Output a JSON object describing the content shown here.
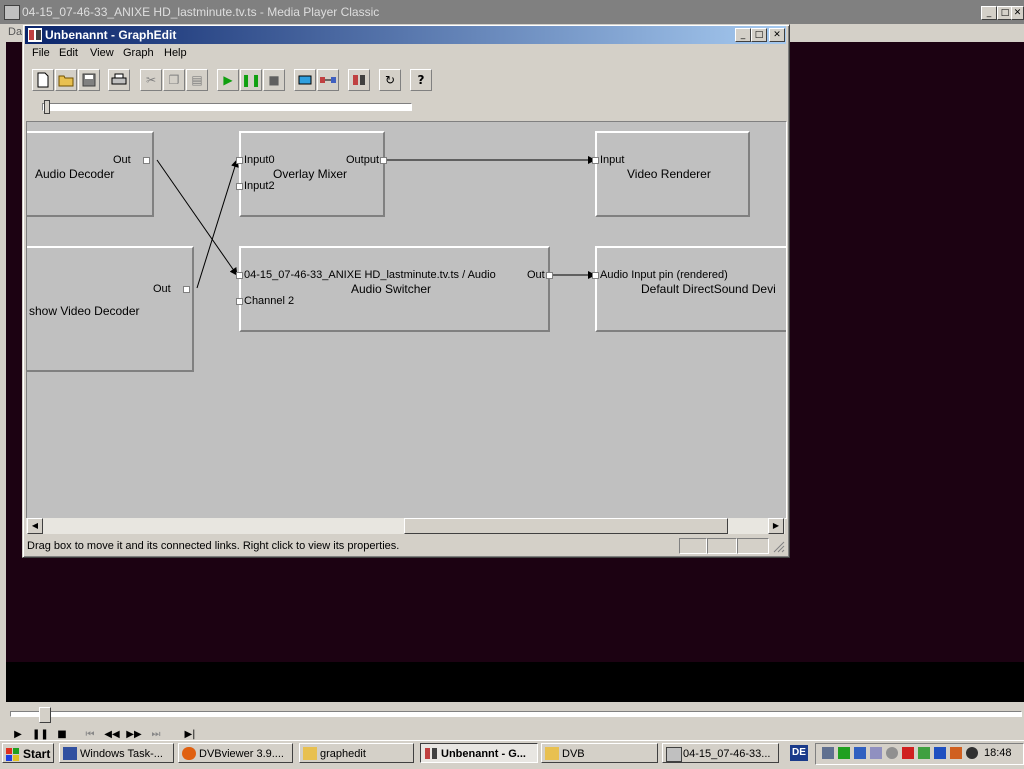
{
  "mpc": {
    "title": "04-15_07-46-33_ANIXE HD_lastminute.tv.ts - Media Player Classic",
    "menu_partial": "Da",
    "playback_buttons": [
      "play-icon",
      "pause-icon",
      "stop-icon",
      "skip-back-icon",
      "frame-back-icon",
      "frame-forward-icon",
      "skip-forward-icon",
      "frame-step-icon"
    ]
  },
  "graphedit": {
    "title": "Unbenannt - GraphEdit",
    "menu": [
      "File",
      "Edit",
      "View",
      "Graph",
      "Help"
    ],
    "toolbar_icons": [
      "new-icon",
      "open-icon",
      "save-icon",
      "print-icon",
      "cut-icon",
      "copy-icon",
      "paste-icon",
      "play-icon",
      "pause-icon",
      "stop-icon",
      "seek-icon",
      "connect-icon",
      "filter-icon",
      "refresh-icon",
      "help-icon"
    ],
    "filters": {
      "audio_decoder": {
        "name": "Audio Decoder",
        "pins": {
          "out": "Out"
        }
      },
      "overlay_mixer": {
        "name": "Overlay Mixer",
        "pins": {
          "input0": "Input0",
          "input2": "Input2",
          "output": "Output"
        }
      },
      "video_renderer": {
        "name": "Video Renderer",
        "pins": {
          "input": "Input"
        }
      },
      "video_decoder": {
        "name": "show Video Decoder",
        "pins": {
          "out": "Out"
        }
      },
      "audio_switcher": {
        "name": "Audio Switcher",
        "pins": {
          "audio": "04-15_07-46-33_ANIXE HD_lastminute.tv.ts / Audio",
          "channel2": "Channel 2",
          "out": "Out"
        }
      },
      "dsound": {
        "name": "Default DirectSound Devi",
        "pins": {
          "input": "Audio Input pin (rendered)"
        }
      }
    },
    "status_text": "Drag box to move it and its connected links. Right click to view its properties."
  },
  "taskbar": {
    "start_label": "Start",
    "buttons": [
      {
        "label": "Windows Task-...",
        "icon": "task-manager-icon"
      },
      {
        "label": "DVBviewer 3.9....",
        "icon": "firefox-icon"
      },
      {
        "label": "graphedit",
        "icon": "folder-icon"
      },
      {
        "label": "Unbenannt - G...",
        "icon": "graphedit-icon",
        "active": true
      },
      {
        "label": "DVB",
        "icon": "folder-icon"
      },
      {
        "label": "04-15_07-46-33...",
        "icon": "media-player-icon"
      }
    ],
    "language": "DE",
    "clock": "18:48"
  }
}
